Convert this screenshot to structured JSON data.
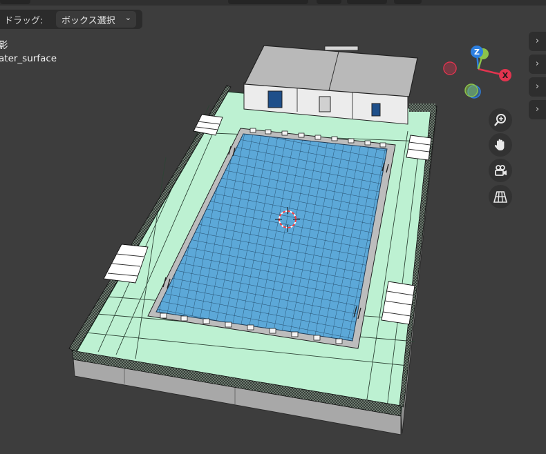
{
  "toolbar": {
    "drag_label": "ドラッグ:",
    "drag_mode_value": "ボックス選択",
    "drag_mode_chevron": "⌄"
  },
  "viewport_overlay": {
    "view_title_partial": "影",
    "object_name_partial": "ater_surface"
  },
  "sidebar_tabs": [
    {
      "icon": "chevron-right-icon",
      "glyph": "›"
    },
    {
      "icon": "chevron-right-icon",
      "glyph": "›"
    },
    {
      "icon": "chevron-right-icon",
      "glyph": "›"
    },
    {
      "icon": "chevron-right-icon",
      "glyph": "›"
    }
  ],
  "gizmo": {
    "z_label": "Z",
    "x_label": "X",
    "colors": {
      "x": "#e2344f",
      "y": "#8bc34a",
      "z": "#2d7fe0"
    }
  },
  "nav_buttons": [
    "zoom-icon",
    "pan-hand-icon",
    "camera-icon",
    "grid-perspective-icon"
  ],
  "scene_colors": {
    "background": "#3d3d3d",
    "deck": "#bdf1d2",
    "water": "#5aa6d6",
    "building_roof": "#b9b9b9",
    "building_wall": "#ececec",
    "base_wall": "#a9a9a9"
  }
}
